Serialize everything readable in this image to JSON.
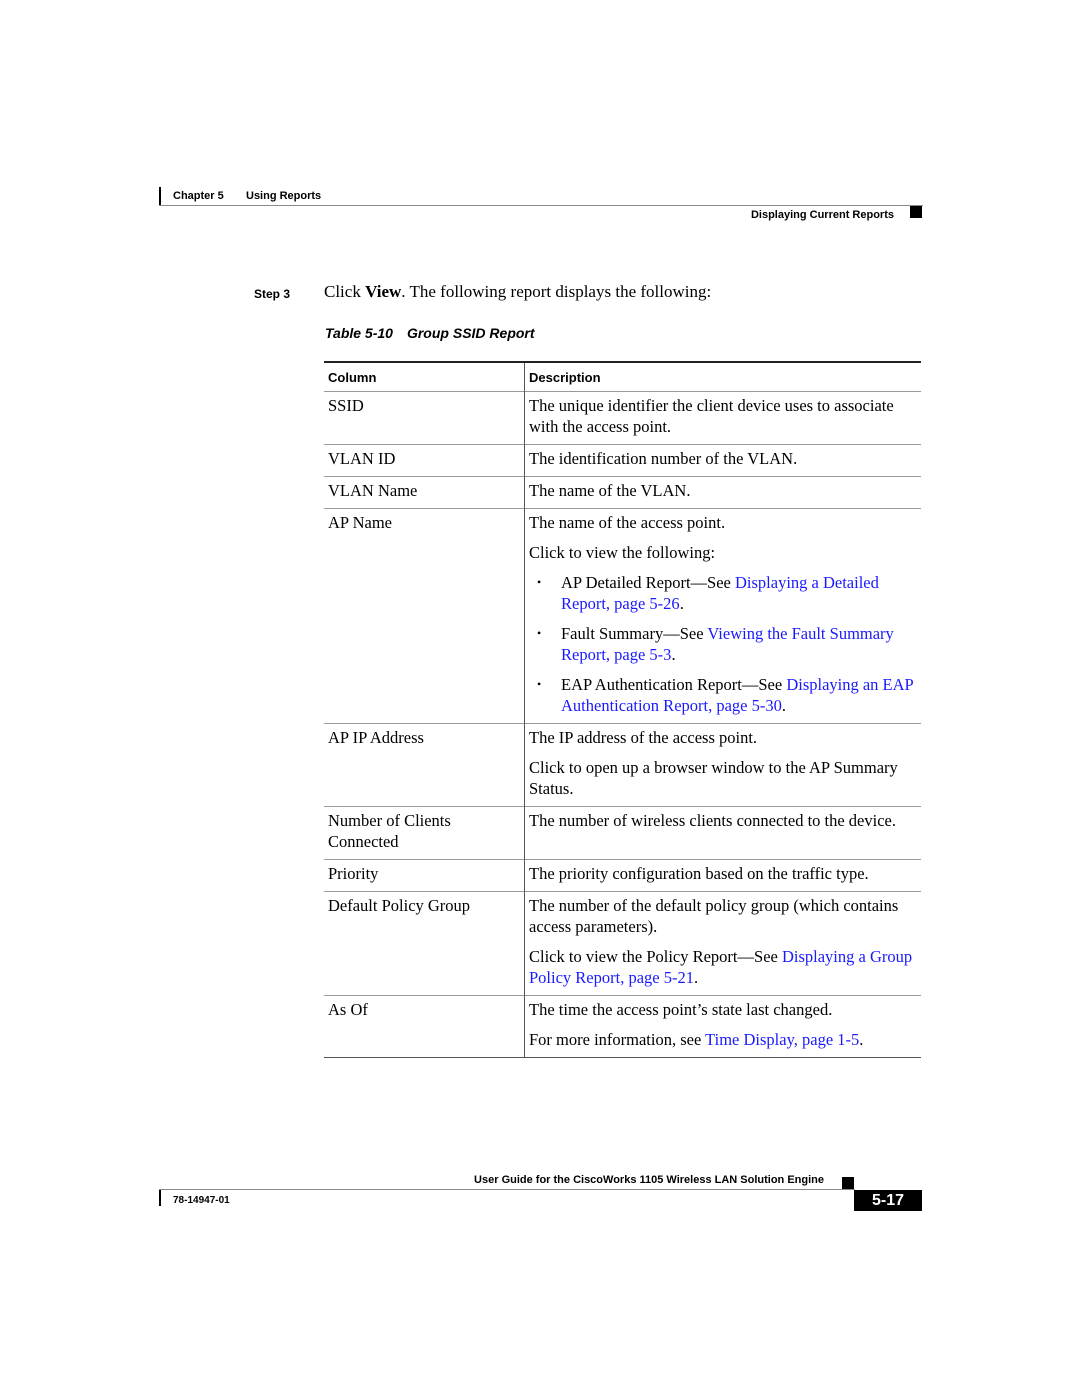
{
  "header": {
    "chapter_label": "Chapter 5",
    "chapter_title": "Using Reports",
    "section_title": "Displaying Current Reports"
  },
  "step": {
    "label": "Step 3",
    "text_pre": "Click ",
    "text_bold": "View",
    "text_post": ". The following report displays the following:"
  },
  "table": {
    "number": "Table 5-10",
    "title": "Group SSID Report",
    "headers": [
      "Column",
      "Description"
    ],
    "rows": [
      {
        "column": "SSID",
        "desc1": "The unique identifier the client device uses to associate with the access point."
      },
      {
        "column": "VLAN ID",
        "desc1": "The identification number of the VLAN."
      },
      {
        "column": "VLAN Name",
        "desc1": "The name of the VLAN."
      },
      {
        "column": "AP Name",
        "desc1": "The name of the access point.",
        "desc2": "Click to view the following:",
        "bullets": [
          {
            "text": "AP Detailed Report—See ",
            "link": "Displaying a Detailed Report, page 5-26",
            "after": "."
          },
          {
            "text": "Fault Summary—See ",
            "link": "Viewing the Fault Summary Report, page 5-3",
            "after": "."
          },
          {
            "text": "EAP Authentication Report—See ",
            "link": "Displaying an EAP Authentication Report, page 5-30",
            "after": "."
          }
        ]
      },
      {
        "column": "AP IP Address",
        "desc1": "The IP address of the access point.",
        "desc2": "Click to open up a browser window to the AP Summary Status."
      },
      {
        "column": "Number of Clients Connected",
        "desc1": "The number of wireless clients connected to the device."
      },
      {
        "column": "Priority",
        "desc1": "The priority configuration based on the traffic type."
      },
      {
        "column": "Default Policy Group",
        "desc1": "The number of the default policy group (which contains access parameters).",
        "desc2_text": "Click to view the Policy Report—See ",
        "desc2_link": "Displaying a Group Policy Report, page 5-21",
        "desc2_after": "."
      },
      {
        "column": "As Of",
        "desc1": "The time the access point’s state last changed.",
        "desc2_text": "For more information, see ",
        "desc2_link": "Time Display, page 1-5",
        "desc2_after": "."
      }
    ]
  },
  "footer": {
    "guide_title": "User Guide for the CiscoWorks 1105 Wireless LAN Solution Engine",
    "doc_number": "78-14947-01",
    "page_number": "5-17"
  },
  "colors": {
    "link": "#1a1aff",
    "text": "#000000"
  }
}
